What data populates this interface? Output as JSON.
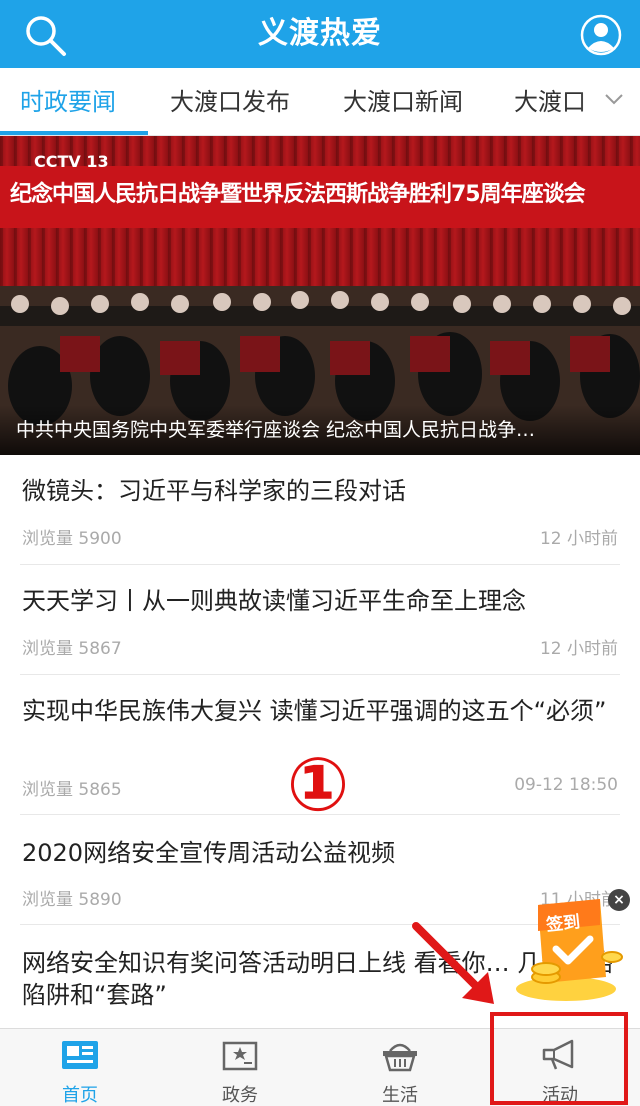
{
  "header": {
    "title": "义渡热爱"
  },
  "tabs": [
    {
      "label": "时政要闻"
    },
    {
      "label": "大渡口发布"
    },
    {
      "label": "大渡口新闻"
    },
    {
      "label": "大渡口"
    }
  ],
  "banner": {
    "slogan": "纪念中国人民抗日战争暨世界反法西斯战争胜利75周年座谈会",
    "channel": "CCTV 13",
    "caption": "中共中央国务院中央军委举行座谈会 纪念中国人民抗日战争…"
  },
  "news": [
    {
      "title": "微镜头：习近平与科学家的三段对话",
      "views": "浏览量 5900",
      "time": "12 小时前"
    },
    {
      "title": "天天学习丨从一则典故读懂习近平生命至上理念",
      "views": "浏览量 5867",
      "time": "12 小时前"
    },
    {
      "title": "实现中华民族伟大复兴 读懂习近平强调的这五个“必须”",
      "views": "浏览量 5865",
      "time": "09-12 18:50"
    },
    {
      "title": "2020网络安全宣传周活动公益视频",
      "views": "浏览量 5890",
      "time": "11 小时前"
    },
    {
      "title": "网络安全知识有奖问答活动明日上线 看看你… 几个网络陷阱和“套路”",
      "views": "",
      "time": ""
    }
  ],
  "annotation": {
    "marker": "①"
  },
  "signin_badge": {
    "label": "签到",
    "close": "×"
  },
  "bottom_nav": [
    {
      "label": "首页",
      "icon": "newspaper-icon"
    },
    {
      "label": "政务",
      "icon": "government-book-icon"
    },
    {
      "label": "生活",
      "icon": "basket-icon"
    },
    {
      "label": "活动",
      "icon": "megaphone-icon"
    }
  ],
  "colors": {
    "primary": "#1fa3e8",
    "annotation_red": "#e01818",
    "banner_red": "#c0161b"
  }
}
